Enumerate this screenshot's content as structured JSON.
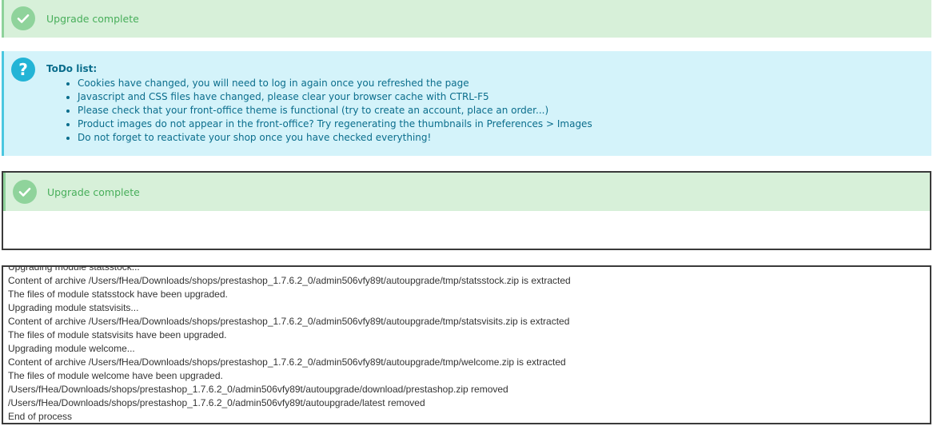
{
  "alerts": {
    "top_success": "Upgrade complete",
    "boxed_success": "Upgrade complete"
  },
  "todo": {
    "title": "ToDo list:",
    "items": [
      "Cookies have changed, you will need to log in again once you refreshed the page",
      "Javascript and CSS files have changed, please clear your browser cache with CTRL-F5",
      "Please check that your front-office theme is functional (try to create an account, place an order...)",
      "Product images do not appear in the front-office? Try regenerating the thumbnails in Preferences > Images",
      "Do not forget to reactivate your shop once you have checked everything!"
    ]
  },
  "log": {
    "lines": [
      "Upgrading module statsstock...",
      "Content of archive /Users/fHea/Downloads/shops/prestashop_1.7.6.2_0/admin506vfy89t/autoupgrade/tmp/statsstock.zip is extracted",
      "The files of module statsstock have been upgraded.",
      "Upgrading module statsvisits...",
      "Content of archive /Users/fHea/Downloads/shops/prestashop_1.7.6.2_0/admin506vfy89t/autoupgrade/tmp/statsvisits.zip is extracted",
      "The files of module statsvisits have been upgraded.",
      "Upgrading module welcome...",
      "Content of archive /Users/fHea/Downloads/shops/prestashop_1.7.6.2_0/admin506vfy89t/autoupgrade/tmp/welcome.zip is extracted",
      "The files of module welcome have been upgraded.",
      "/Users/fHea/Downloads/shops/prestashop_1.7.6.2_0/admin506vfy89t/autoupgrade/download/prestashop.zip removed",
      "/Users/fHea/Downloads/shops/prestashop_1.7.6.2_0/admin506vfy89t/autoupgrade/latest removed",
      "End of process"
    ]
  },
  "icons": {
    "success": "check-circle-icon",
    "info": "question-circle-icon"
  },
  "colors": {
    "success_bg": "#d7f0d9",
    "success_text": "#47ae5a",
    "info_bg": "#d4f3fa",
    "info_text": "#0a6d8c"
  }
}
